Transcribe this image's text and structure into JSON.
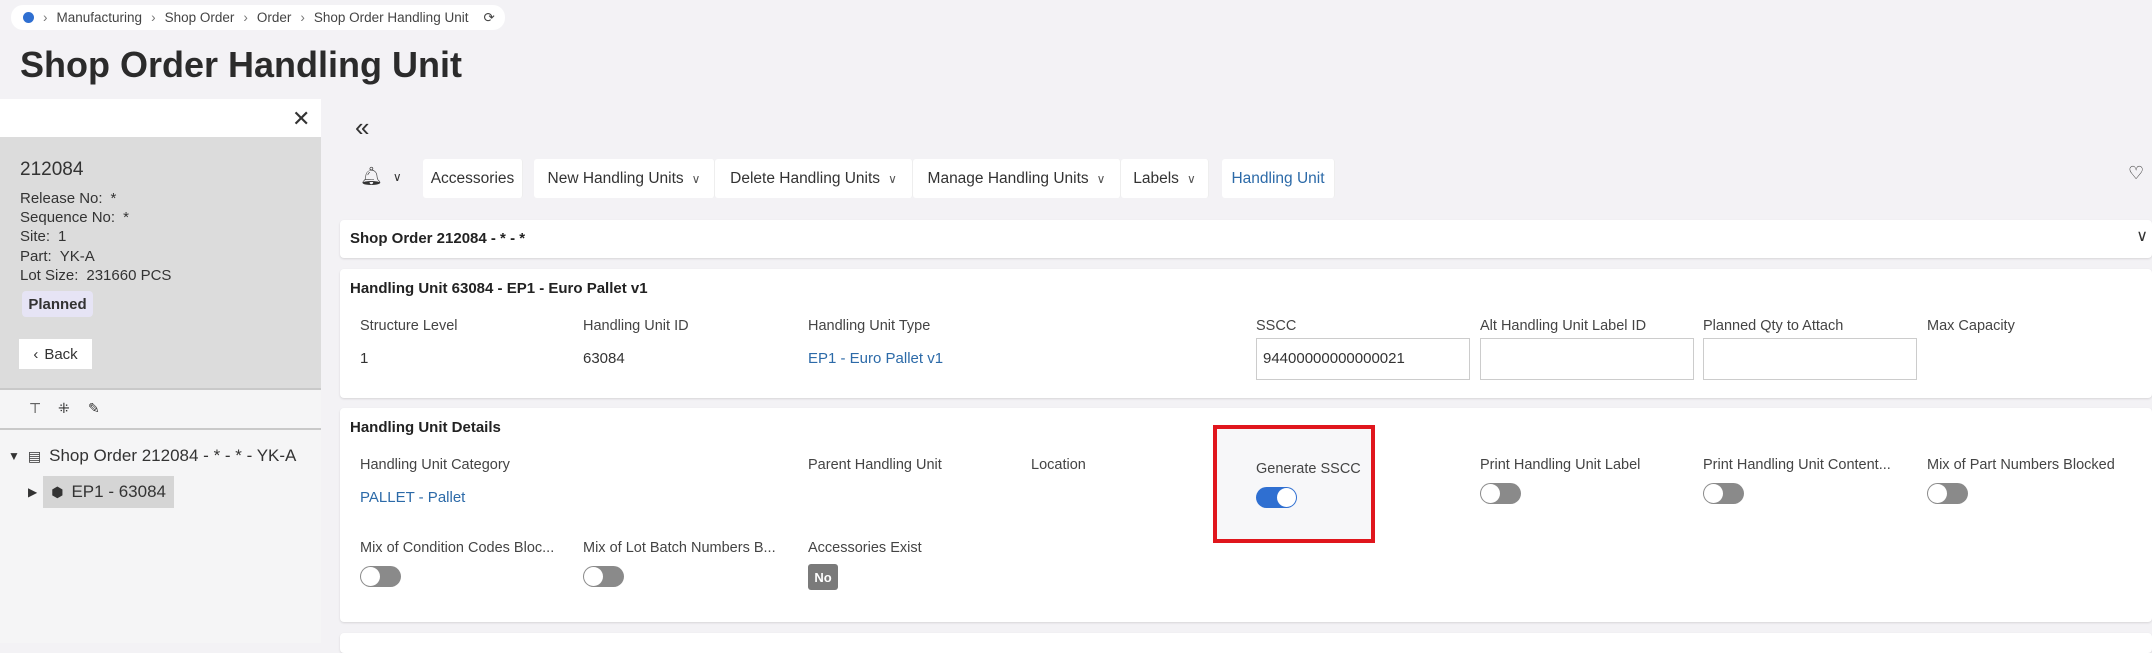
{
  "breadcrumb": {
    "items": [
      "Manufacturing",
      "Shop Order",
      "Order",
      "Shop Order Handling Unit"
    ]
  },
  "page_title": "Shop Order Handling Unit",
  "left_panel": {
    "order_no": "212084",
    "fields": [
      {
        "label": "Release No:",
        "value": "*"
      },
      {
        "label": "Sequence No:",
        "value": "*"
      },
      {
        "label": "Site:",
        "value": "1"
      },
      {
        "label": "Part:",
        "value": "YK-A"
      },
      {
        "label": "Lot Size:",
        "value": "231660 PCS"
      }
    ],
    "status": "Planned",
    "back_label": "Back",
    "tree": {
      "root": "Shop Order 212084 - * - * - YK-A",
      "child": "EP1 - 63084"
    }
  },
  "toolbar": {
    "buttons": [
      "Accessories",
      "New Handling Units",
      "Delete Handling Units",
      "Manage Handling Units",
      "Labels",
      "Handling Unit"
    ]
  },
  "shop_order_card": {
    "title": "Shop Order 212084 - * - *"
  },
  "hu_card": {
    "title": "Handling Unit 63084 - EP1 - Euro Pallet v1",
    "structure_level": {
      "label": "Structure Level",
      "value": "1"
    },
    "hu_id": {
      "label": "Handling Unit ID",
      "value": "63084"
    },
    "hu_type": {
      "label": "Handling Unit Type",
      "value": "EP1 - Euro Pallet v1"
    },
    "sscc": {
      "label": "SSCC",
      "value": "94400000000000021"
    },
    "alt_label": {
      "label": "Alt Handling Unit Label ID",
      "value": ""
    },
    "planned_qty": {
      "label": "Planned Qty to Attach",
      "value": ""
    },
    "max_capacity": {
      "label": "Max Capacity"
    }
  },
  "details_card": {
    "title": "Handling Unit Details",
    "category": {
      "label": "Handling Unit Category",
      "value": "PALLET - Pallet"
    },
    "parent": {
      "label": "Parent Handling Unit"
    },
    "location": {
      "label": "Location"
    },
    "generate_sscc": {
      "label": "Generate SSCC",
      "on": true
    },
    "print_label": {
      "label": "Print Handling Unit Label",
      "on": false
    },
    "print_content": {
      "label": "Print Handling Unit Content...",
      "on": false
    },
    "mix_part": {
      "label": "Mix of Part Numbers Blocked",
      "on": false
    },
    "mix_condition": {
      "label": "Mix of Condition Codes Bloc...",
      "on": false
    },
    "mix_lot": {
      "label": "Mix of Lot Batch Numbers B...",
      "on": false
    },
    "accessories": {
      "label": "Accessories Exist",
      "value": "No"
    }
  }
}
